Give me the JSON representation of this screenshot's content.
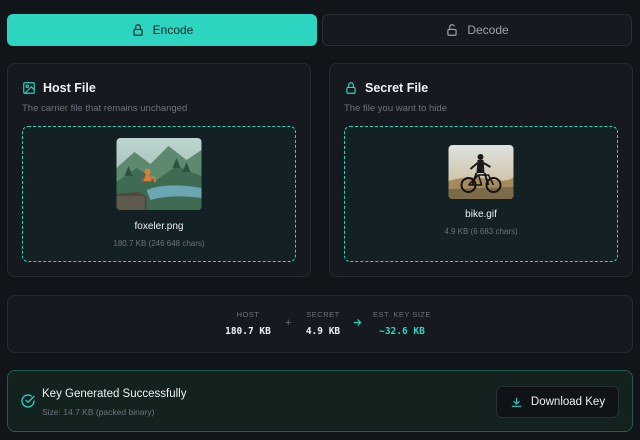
{
  "tabs": {
    "encode_label": "Encode",
    "decode_label": "Decode"
  },
  "host": {
    "title": "Host File",
    "subtitle": "The carrier file that remains unchanged",
    "file_name": "foxeler.png",
    "file_meta": "180.7 KB (246 648 chars)"
  },
  "secret": {
    "title": "Secret File",
    "subtitle": "The file you want to hide",
    "file_name": "bike.gif",
    "file_meta": "4.9 KB (6 683 chars)"
  },
  "stats": {
    "host_label": "HOST",
    "host_value": "180.7 KB",
    "plus": "+",
    "secret_label": "SECRET",
    "secret_value": "4.9 KB",
    "key_label": "EST. KEY SIZE",
    "key_value": "~32.6 KB"
  },
  "result": {
    "title": "Key Generated Successfully",
    "subtitle": "Size: 14.7 KB (packed binary)",
    "download_label": "Download Key"
  },
  "colors": {
    "accent": "#2dd4bf",
    "background": "#111418",
    "panel": "#16191f"
  }
}
